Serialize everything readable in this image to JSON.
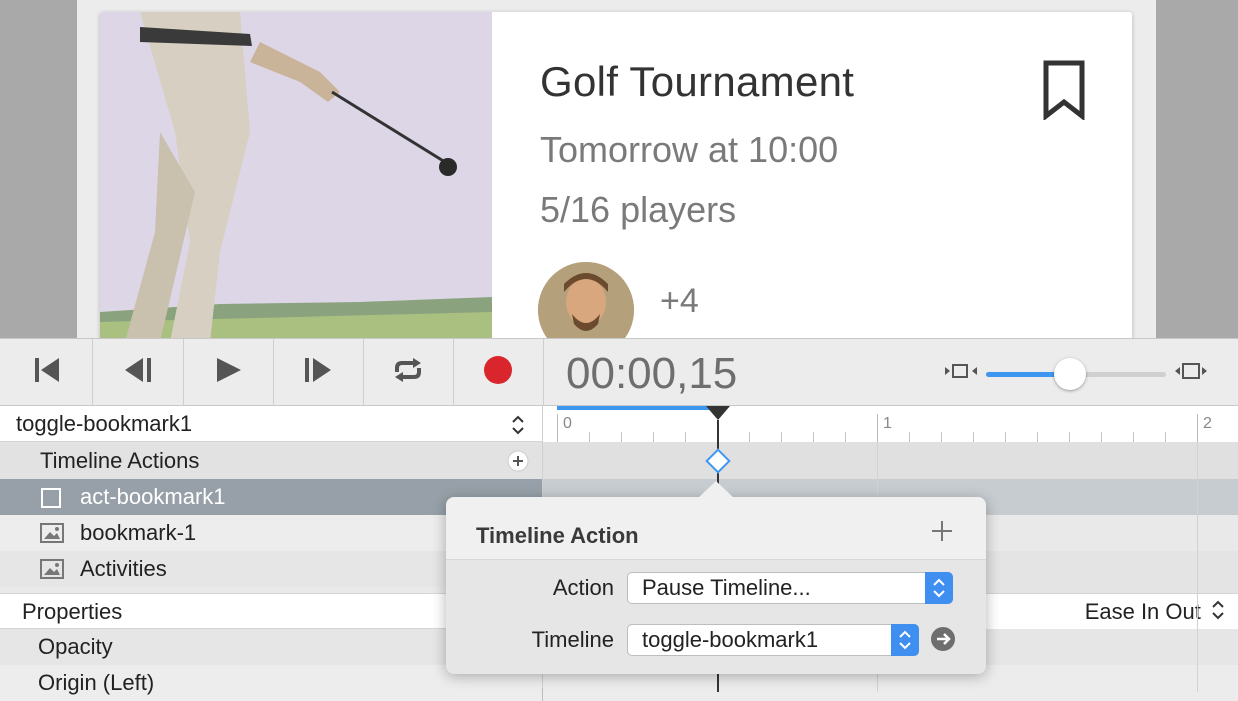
{
  "card": {
    "title": "Golf Tournament",
    "time": "Tomorrow at 10:00",
    "players": "5/16 players",
    "extra_players": "+4"
  },
  "transport": {
    "time": "00:00,15",
    "buttons": [
      "go-to-start",
      "step-back",
      "play",
      "step-forward",
      "loop",
      "record"
    ],
    "zoom_level": 0.42
  },
  "timeline_select": {
    "value": "toggle-bookmark1"
  },
  "layers": {
    "actions_label": "Timeline Actions",
    "items": [
      {
        "label": "act-bookmark1"
      },
      {
        "label": "bookmark-1"
      },
      {
        "label": "Activities"
      }
    ]
  },
  "properties": {
    "header": "Properties",
    "easing": "Ease In Out",
    "items": [
      "Opacity",
      "Origin (Left)"
    ]
  },
  "ruler": {
    "ticks": [
      "0",
      "1",
      "2"
    ],
    "playhead_seconds": 0.5
  },
  "popover": {
    "title": "Timeline Action",
    "action_label": "Action",
    "action_value": "Pause Timeline...",
    "timeline_label": "Timeline",
    "timeline_value": "toggle-bookmark1"
  },
  "colors": {
    "accent": "#3f96f0",
    "record": "#d9262c",
    "selected_row": "#97a0a8"
  }
}
